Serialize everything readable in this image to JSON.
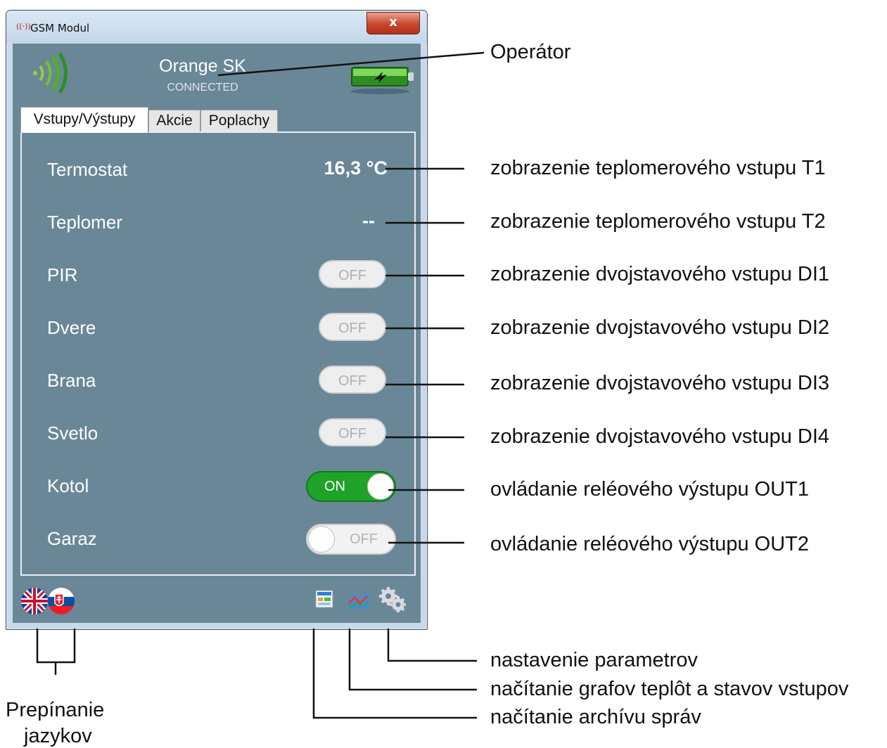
{
  "window": {
    "title": "GSM Modul",
    "close_glyph": "x",
    "app_icon": "antenna-icon"
  },
  "header": {
    "operator": "Orange SK",
    "status": "CONNECTED",
    "signal_icon": "signal-strength-icon",
    "battery_icon": "battery-charging-icon"
  },
  "tabs": [
    {
      "label": "Vstupy/Výstupy",
      "active": true
    },
    {
      "label": "Akcie",
      "active": false
    },
    {
      "label": "Poplachy",
      "active": false
    }
  ],
  "rows": [
    {
      "label": "Termostat",
      "value": "16,3 °C"
    },
    {
      "label": "Teplomer",
      "value": "--"
    },
    {
      "label": "PIR",
      "state": "OFF"
    },
    {
      "label": "Dvere",
      "state": "OFF"
    },
    {
      "label": "Brana",
      "state": "OFF"
    },
    {
      "label": "Svetlo",
      "state": "OFF"
    },
    {
      "label": "Kotol",
      "state": "ON"
    },
    {
      "label": "Garaz",
      "state": "OFF"
    }
  ],
  "footer": {
    "flags": [
      "uk-flag-icon",
      "slovak-flag-icon"
    ],
    "icons": [
      "message-archive-icon",
      "chart-icon",
      "settings-gears-icon"
    ]
  },
  "annotations": {
    "operator": "Operátor",
    "t1": "zobrazenie teplomerového vstupu T1",
    "t2": "zobrazenie teplomerového vstupu T2",
    "di1": "zobrazenie dvojstavového vstupu DI1",
    "di2": "zobrazenie dvojstavového vstupu DI2",
    "di3": "zobrazenie dvojstavového vstupu DI3",
    "di4": "zobrazenie dvojstavového vstupu DI4",
    "out1": "ovládanie reléového výstupu OUT1",
    "out2": "ovládanie reléového výstupu OUT2",
    "settings": "nastavenie parametrov",
    "graphs": "načítanie grafov teplôt a stavov vstupov",
    "archive": "načítanie archívu správ",
    "language_line1": "Prepínanie",
    "language_line2": "jazykov"
  },
  "colors": {
    "panel": "#6a8797",
    "toggle_on": "#1fa32a"
  }
}
